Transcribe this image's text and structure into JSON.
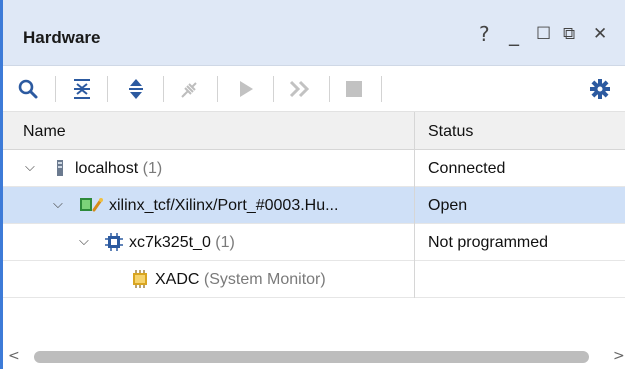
{
  "window": {
    "title": "Hardware",
    "controls": {
      "help": "?",
      "minimize": "_",
      "maximize": "☐",
      "float": "⧉",
      "close": "✕"
    }
  },
  "toolbar": {
    "icons": [
      "search-icon",
      "collapse-all-icon",
      "expand-all-icon",
      "auto-connect-icon",
      "run-icon",
      "run-all-icon",
      "stop-icon",
      "settings-icon"
    ]
  },
  "table": {
    "columns": [
      "Name",
      "Status"
    ],
    "rows": [
      {
        "name": "localhost",
        "count": "(1)",
        "status": "Connected",
        "level": 0,
        "expanded": true,
        "icon": "server-icon"
      },
      {
        "name": "xilinx_tcf/Xilinx/Port_#0003.Hu...",
        "count": "",
        "status": "Open",
        "level": 1,
        "expanded": true,
        "icon": "jtag-cable-icon",
        "selected": true
      },
      {
        "name": "xc7k325t_0",
        "count": "(1)",
        "status": "Not programmed",
        "level": 2,
        "expanded": true,
        "icon": "fpga-chip-icon"
      },
      {
        "name": "XADC",
        "count": "(System Monitor)",
        "status": "",
        "level": 3,
        "expanded": false,
        "icon": "xadc-icon"
      }
    ]
  },
  "scrollbar": {
    "left_arrow": "<",
    "right_arrow": ">"
  },
  "colors": {
    "accent": "#3d7bd8",
    "title_bar": "#dfe8f6",
    "selected_row": "#cfe0f7",
    "header": "#f0f0f0"
  }
}
